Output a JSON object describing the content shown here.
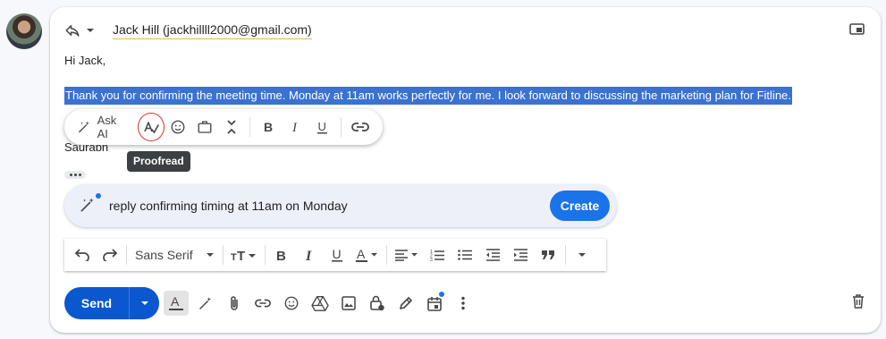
{
  "header": {
    "recipient": "Jack Hill (jackhillll2000@gmail.com)"
  },
  "body": {
    "greeting": "Hi Jack,",
    "selected_text": "Thank you for confirming the meeting time. Monday at 11am works perfectly for me. I look forward to discussing the marketing plan for Fitline.",
    "signature": "Saurabh"
  },
  "format_bar": {
    "ask_ai_label": "Ask AI",
    "tooltip": "Proofread"
  },
  "ai_prompt": {
    "text": "reply confirming timing at 11am on Monday",
    "create_label": "Create"
  },
  "toolbar": {
    "font": "Sans Serif"
  },
  "send": {
    "label": "Send"
  },
  "colors": {
    "accent": "#0b57d0",
    "create": "#1a73e8",
    "selection": "#3b72cf",
    "proofread_ring": "#d93025"
  }
}
